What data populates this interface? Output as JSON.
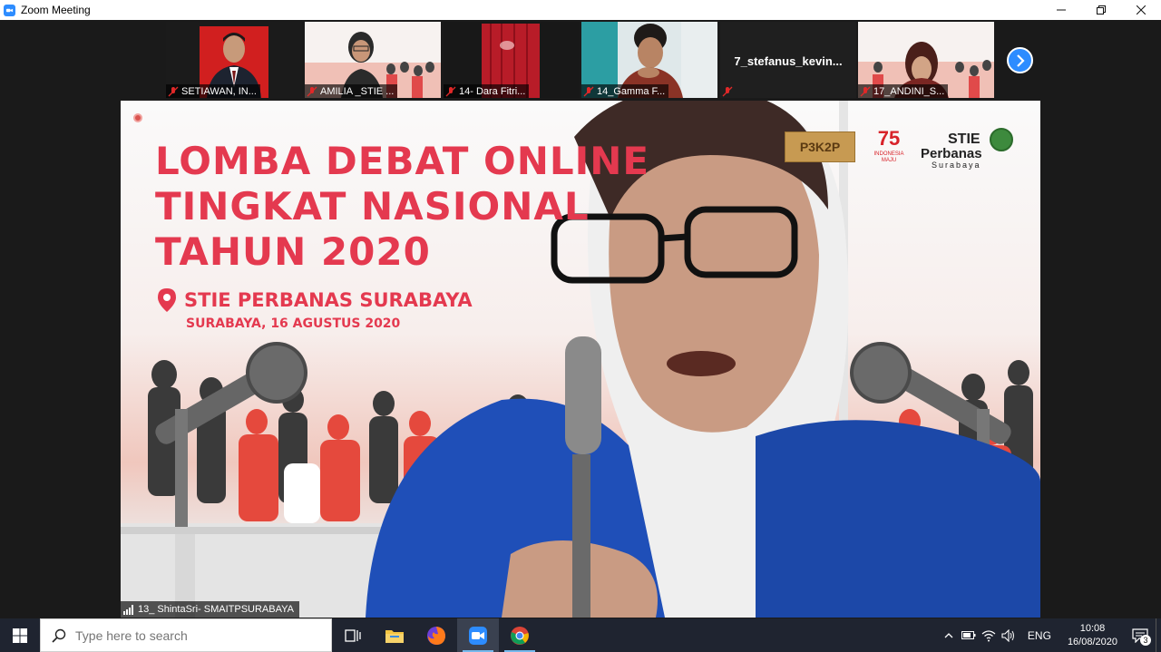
{
  "window": {
    "title": "Zoom Meeting"
  },
  "thumbnails": [
    {
      "name": "SETIAWAN, IN...",
      "muted": true
    },
    {
      "name": "AMILIA _STIE ...",
      "muted": true
    },
    {
      "name": "14- Dara Fitri...",
      "muted": true
    },
    {
      "name": "14_Gamma F...",
      "muted": true
    },
    {
      "name": "",
      "display_name": "7_stefanus_kevin...",
      "muted": true
    },
    {
      "name": "17_ANDINI_S...",
      "muted": true
    }
  ],
  "slide": {
    "headline_1": "LOMBA DEBAT ONLINE",
    "headline_2": "TINGKAT NASIONAL",
    "headline_3": "TAHUN 2020",
    "location": "STIE PERBANAS SURABAYA",
    "date": "SURABAYA, 16 AGUSTUS 2020",
    "logo_p3k2p": "P3K2P",
    "logo_ri_number": "75",
    "logo_ri_text": "INDONESIA MAJU",
    "logo_stie_1": "STIE",
    "logo_stie_2": "Perbanas",
    "logo_stie_3": "Surabaya"
  },
  "active_speaker": {
    "name": "13_ ShintaSri- SMAITPSURABAYA"
  },
  "taskbar": {
    "search_placeholder": "Type here to search",
    "language": "ENG",
    "time": "10:08",
    "date": "16/08/2020",
    "notification_count": "3"
  },
  "colors": {
    "accent": "#2d8cff",
    "slide_red": "#e4394f",
    "taskbar": "#1f2430"
  }
}
